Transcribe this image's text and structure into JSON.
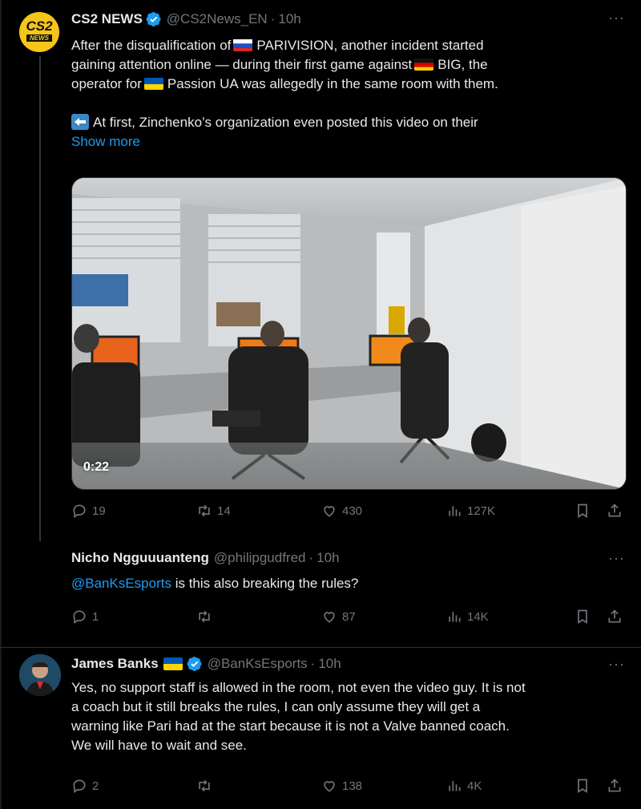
{
  "tweet1": {
    "avatar_text_top": "CS2",
    "avatar_text_bottom": "NEWS",
    "name": "CS2 NEWS",
    "handle": "@CS2News_EN",
    "time": "10h",
    "line1_pre": "After the disqualification of",
    "line1_post": "PARIVISION, another incident started",
    "line2_pre": "gaining attention online — during their first game against",
    "line2_post": "BIG, the",
    "line3_pre": "operator for",
    "line3_post": "Passion UA was allegedly in the same room with them.",
    "para2": "At first, Zinchenko’s organization even posted this video on their",
    "show_more": "Show more",
    "video_duration": "0:22",
    "replies": "19",
    "reposts": "14",
    "likes": "430",
    "views": "127K"
  },
  "tweet2": {
    "name": "Nicho Ngguuuanteng",
    "handle": "@philipgudfred",
    "time": "10h",
    "mention": "@BanKsEsports",
    "text": " is this also breaking the rules?",
    "replies": "1",
    "reposts": "",
    "likes": "87",
    "views": "14K"
  },
  "tweet3": {
    "name": "James Banks",
    "handle": "@BanKsEsports",
    "time": "10h",
    "lines": [
      "Yes, no support staff is allowed in the room, not even the video guy. It is not",
      "a coach but it still breaks the rules, I can only assume they will get a",
      "warning like Pari had at the start because it is not a Valve banned coach.",
      "We will have to wait and see."
    ],
    "replies": "2",
    "reposts": "",
    "likes": "138",
    "views": "4K"
  },
  "colors": {
    "accent": "#1d9bf0",
    "muted": "#71767b",
    "text": "#e7e9ea",
    "cs2_yellow": "#f5c518"
  }
}
